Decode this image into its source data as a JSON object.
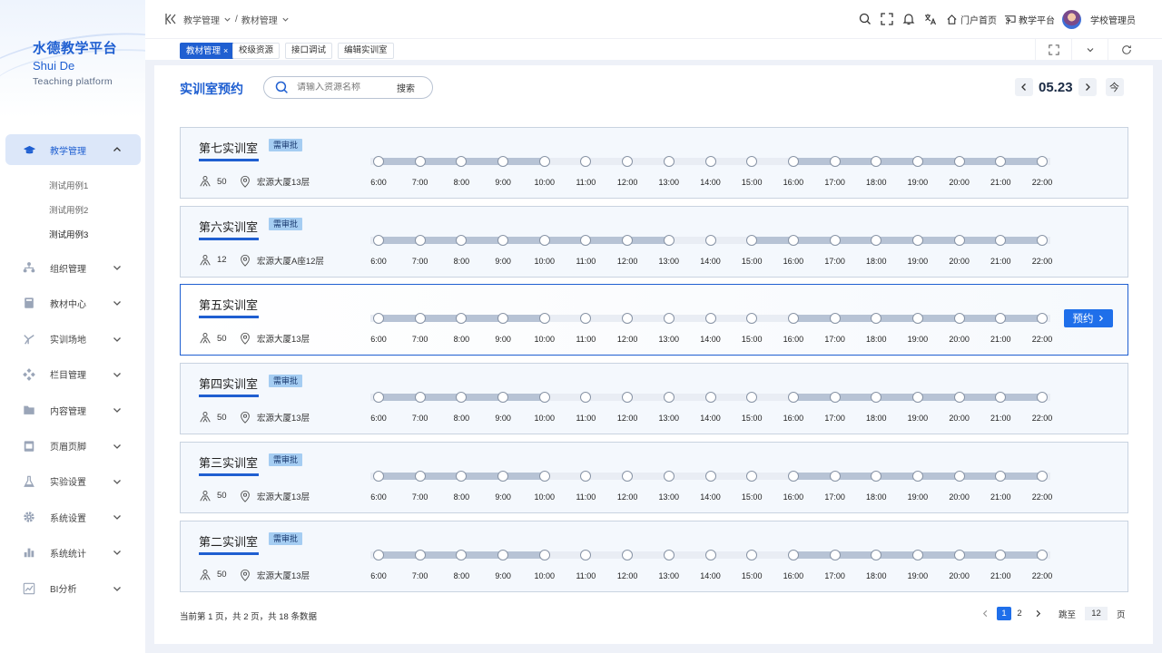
{
  "brand": {
    "title_cn": "水德教学平台",
    "title_en": "Shui De",
    "subtitle_en": "Teaching  platform"
  },
  "sidebar": {
    "items": [
      {
        "label": "教学管理",
        "icon": "graduation-cap-icon",
        "active": true,
        "expanded": true,
        "children": [
          {
            "label": "测试用例1"
          },
          {
            "label": "测试用例2"
          },
          {
            "label": "测试用例3",
            "current": true
          }
        ]
      },
      {
        "label": "组织管理",
        "icon": "org-tree-icon"
      },
      {
        "label": "教材中心",
        "icon": "book-icon"
      },
      {
        "label": "实训场地",
        "icon": "venue-icon"
      },
      {
        "label": "栏目管理",
        "icon": "columns-icon"
      },
      {
        "label": "内容管理",
        "icon": "folder-icon"
      },
      {
        "label": "页眉页脚",
        "icon": "header-footer-icon"
      },
      {
        "label": "实验设置",
        "icon": "flask-icon"
      },
      {
        "label": "系统设置",
        "icon": "gear-icon"
      },
      {
        "label": "系统统计",
        "icon": "stats-icon"
      },
      {
        "label": "BI分析",
        "icon": "line-chart-icon"
      }
    ]
  },
  "header": {
    "breadcrumb": [
      "教学管理",
      "教材管理"
    ],
    "portal_label": "门户首页",
    "platform_label": "教学平台",
    "user_name": "学校管理员",
    "icons": [
      "search-icon",
      "fullscreen-icon",
      "bell-icon",
      "translate-icon"
    ]
  },
  "tabs": [
    {
      "label": "教材管理",
      "active": true,
      "closable": true
    },
    {
      "label": "校级资源"
    },
    {
      "label": "接口调试"
    },
    {
      "label": "编辑实训室"
    }
  ],
  "main": {
    "title": "实训室预约",
    "search": {
      "placeholder": "请输入资源名称",
      "value": "",
      "button": "搜索"
    },
    "date": "05.23",
    "today_label": "今",
    "reserve_label": "预约",
    "time_labels": [
      "6:00",
      "7:00",
      "8:00",
      "9:00",
      "10:00",
      "11:00",
      "12:00",
      "13:00",
      "14:00",
      "15:00",
      "16:00",
      "17:00",
      "18:00",
      "19:00",
      "20:00",
      "21:00",
      "22:00"
    ],
    "rooms": [
      {
        "name": "第七实训室",
        "badge": "需审批",
        "capacity": "50",
        "location": "宏源大厦13层",
        "booked": [
          [
            6,
            10
          ],
          [
            16,
            22
          ]
        ]
      },
      {
        "name": "第六实训室",
        "badge": "需审批",
        "capacity": "12",
        "location": "宏源大厦A座12层",
        "booked": [
          [
            6,
            13
          ],
          [
            15,
            22
          ]
        ]
      },
      {
        "name": "第五实训室",
        "badge": "",
        "capacity": "50",
        "location": "宏源大厦13层",
        "booked": [
          [
            6,
            10
          ],
          [
            16,
            22
          ]
        ],
        "highlighted": true
      },
      {
        "name": "第四实训室",
        "badge": "需审批",
        "capacity": "50",
        "location": "宏源大厦13层",
        "booked": [
          [
            6,
            10
          ],
          [
            16,
            22
          ]
        ]
      },
      {
        "name": "第三实训室",
        "badge": "需审批",
        "capacity": "50",
        "location": "宏源大厦13层",
        "booked": [
          [
            6,
            10
          ],
          [
            16,
            22
          ]
        ]
      },
      {
        "name": "第二实训室",
        "badge": "需审批",
        "capacity": "50",
        "location": "宏源大厦13层",
        "booked": [
          [
            6,
            10
          ],
          [
            16,
            22
          ]
        ]
      }
    ]
  },
  "pagination": {
    "info": "当前第 1 页，共 2 页，共 18 条数据",
    "pages": [
      "1",
      "2"
    ],
    "current": "1",
    "jump_label": "跳至",
    "jump_value": "12",
    "page_suffix": "页"
  },
  "colors": {
    "accent": "#1f5fd1",
    "button": "#1f6fea",
    "badge": "#a5cdf2",
    "booked": "#b7c3d5"
  }
}
